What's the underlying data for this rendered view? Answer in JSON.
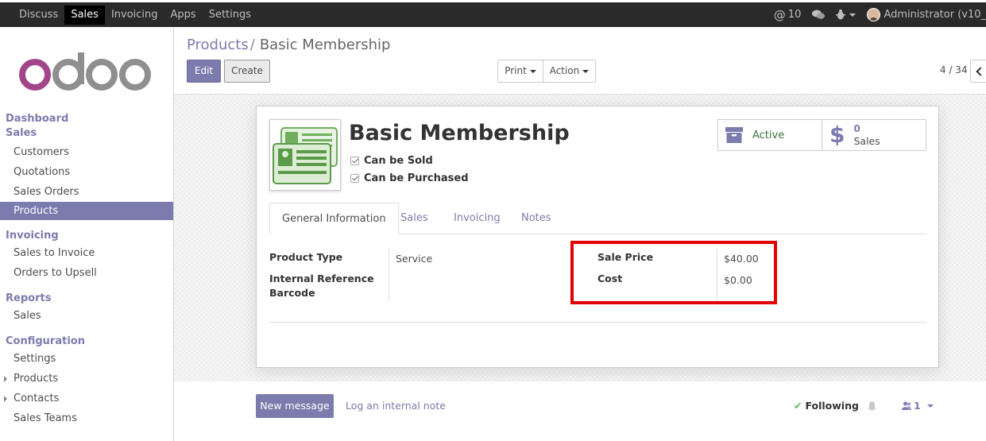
{
  "navbar": {
    "apps": [
      "Discuss",
      "Sales",
      "Invoicing",
      "Apps",
      "Settings"
    ],
    "active_app": "Sales",
    "messages_count": "10",
    "user_name": "Administrator (v10_"
  },
  "sidebar": {
    "logo_text": "odoo",
    "sections": [
      {
        "title": "Dashboard"
      },
      {
        "title": "Sales",
        "items": [
          "Customers",
          "Quotations",
          "Sales Orders",
          "Products"
        ]
      },
      {
        "title": "Invoicing",
        "items": [
          "Sales to Invoice",
          "Orders to Upsell"
        ]
      },
      {
        "title": "Reports",
        "items": [
          "Sales"
        ]
      },
      {
        "title": "Configuration",
        "items": [
          "Settings",
          "Products",
          "Contacts",
          "Sales Teams"
        ]
      }
    ],
    "active_item": "Products"
  },
  "breadcrumb": {
    "parent": "Products",
    "separator": "/",
    "current": "Basic Membership"
  },
  "toolbar": {
    "edit": "Edit",
    "create": "Create",
    "print": "Print",
    "action": "Action",
    "pager": "4 / 34"
  },
  "product": {
    "name": "Basic Membership",
    "can_be_sold": "Can be Sold",
    "can_be_purchased": "Can be Purchased",
    "stat_active": "Active",
    "stat_sales_count": "0",
    "stat_sales_label": "Sales"
  },
  "tabs": [
    "General Information",
    "Sales",
    "Invoicing",
    "Notes"
  ],
  "fields": {
    "product_type_label": "Product Type",
    "product_type_value": "Service",
    "internal_ref_label": "Internal Reference",
    "barcode_label": "Barcode",
    "sale_price_label": "Sale Price",
    "sale_price_value": "$40.00",
    "cost_label": "Cost",
    "cost_value": "$0.00"
  },
  "chatter": {
    "new_message": "New message",
    "log_note": "Log an internal note",
    "following": "Following",
    "followers_count": "1"
  },
  "colors": {
    "brand": "#7c7bad",
    "highlight": "#e00000",
    "active_green": "#3c763d"
  }
}
